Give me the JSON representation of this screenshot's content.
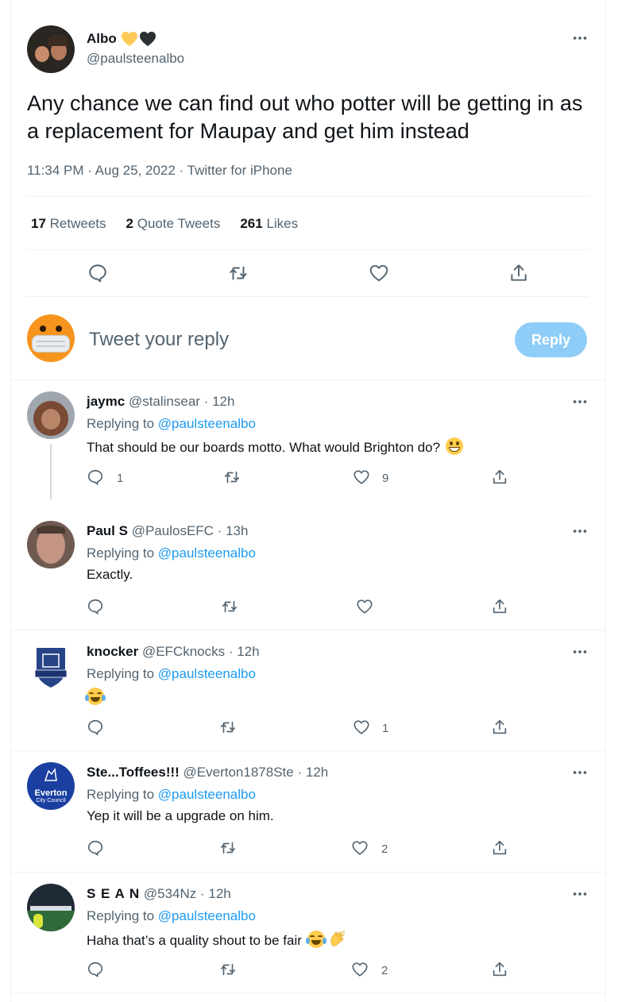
{
  "main_tweet": {
    "author_name": "Albo",
    "author_handle": "@paulsteenalbo",
    "text": "Any chance we can find out who potter will be getting in as a replacement for Maupay and get him instead",
    "meta": "11:34 PM · Aug 25, 2022 · Twitter for iPhone",
    "stats": {
      "retweets_count": "17",
      "retweets_label": "Retweets",
      "quotes_count": "2",
      "quotes_label": "Quote Tweets",
      "likes_count": "261",
      "likes_label": "Likes"
    }
  },
  "composer": {
    "placeholder": "Tweet your reply",
    "button": "Reply"
  },
  "replies": [
    {
      "name": "jaymc",
      "handle": "@stalinsear",
      "time": "· 12h",
      "replying_prefix": "Replying to",
      "replying_to": "@paulsteenalbo",
      "text": "That should be our boards motto. What would Brighton do?",
      "reply_count": "1",
      "retweet_count": "",
      "like_count": "9",
      "avatar_color": "#8a6d5c"
    },
    {
      "name": "Paul S",
      "handle": "@PaulosEFC",
      "time": "· 13h",
      "replying_prefix": "Replying to",
      "replying_to": "@paulsteenalbo",
      "text": "Exactly.",
      "reply_count": "",
      "retweet_count": "",
      "like_count": "",
      "avatar_color": "#b07e6e"
    },
    {
      "name": "knocker",
      "handle": "@EFCknocks",
      "time": "· 12h",
      "replying_prefix": "Replying to",
      "replying_to": "@paulsteenalbo",
      "text": "",
      "reply_count": "",
      "retweet_count": "",
      "like_count": "1",
      "avatar_color": "#274488"
    },
    {
      "name": "Ste...Toffees!!!",
      "handle": "@Everton1878Ste",
      "time": "· 12h",
      "replying_prefix": "Replying to",
      "replying_to": "@paulsteenalbo",
      "text": "Yep it will be a upgrade on him.",
      "reply_count": "",
      "retweet_count": "",
      "like_count": "2",
      "avatar_color": "#1a3fa0",
      "avatar_text": "Everton",
      "avatar_subtext": "City Council"
    },
    {
      "name": "S E A N",
      "handle": "@534Nz",
      "time": "· 12h",
      "replying_prefix": "Replying to",
      "replying_to": "@paulsteenalbo",
      "text": "Haha that’s a quality shout to be fair",
      "reply_count": "",
      "retweet_count": "",
      "like_count": "2",
      "avatar_color": "#3a4b5c"
    }
  ],
  "colors": {
    "accent": "#1d9bf0",
    "reply_button_disabled": "#8ecdf8",
    "text_secondary": "#536471"
  },
  "icons": [
    "more-icon",
    "reply-icon",
    "retweet-icon",
    "like-icon",
    "share-icon",
    "yellow-heart-emoji",
    "black-heart-emoji",
    "grin-emoji",
    "tears-of-joy-emoji",
    "clapping-emoji"
  ]
}
